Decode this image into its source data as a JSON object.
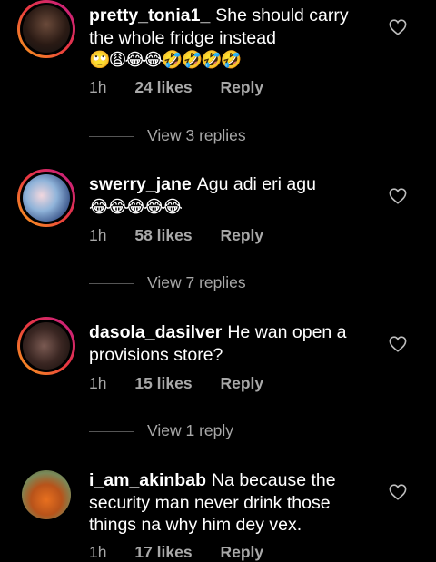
{
  "comments": [
    {
      "username": "pretty_tonia1_",
      "text": "She should carry the whole fridge instead",
      "emojis": "🙄😩😂😂🤣🤣🤣🤣",
      "time": "1h",
      "likes": "24 likes",
      "reply": "Reply",
      "view_replies": "View 3 replies"
    },
    {
      "username": "swerry_jane",
      "text": "Agu adi eri agu",
      "emojis": "😂😂😂😂😂",
      "time": "1h",
      "likes": "58 likes",
      "reply": "Reply",
      "view_replies": "View 7 replies"
    },
    {
      "username": "dasola_dasilver",
      "text": "He wan open a provisions store?",
      "emojis": "",
      "time": "1h",
      "likes": "15 likes",
      "reply": "Reply",
      "view_replies": "View 1 reply"
    },
    {
      "username": "i_am_akinbab",
      "text": "Na because the security man never drink those things na why him dey vex.",
      "emojis": "",
      "time": "1h",
      "likes": "17 likes",
      "reply": "Reply",
      "view_replies": ""
    }
  ],
  "colors": {
    "background": "#000000",
    "text": "#ffffff",
    "secondary": "#a8a8a8"
  },
  "icons": {
    "like": "heart-outline-icon"
  }
}
